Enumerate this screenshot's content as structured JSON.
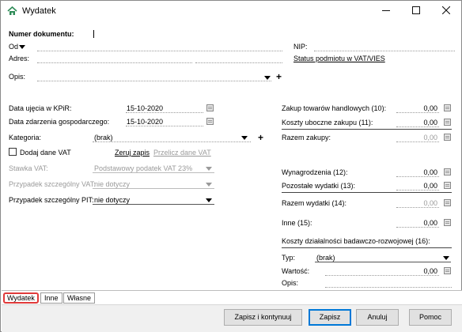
{
  "window": {
    "title": "Wydatek",
    "minimize_icon": "minimize-icon",
    "maximize_icon": "maximize-icon",
    "close_icon": "close-icon"
  },
  "header": {
    "numer_label": "Numer dokumentu:",
    "od_label": "Od",
    "adres_label": "Adres:",
    "nip_label": "NIP:",
    "status_link": "Status podmiotu w VAT/VIES",
    "opis_label": "Opis:"
  },
  "left": {
    "data_ujecia_label": "Data ujęcia w KPiR:",
    "data_ujecia_value": "15-10-2020",
    "data_zdarzenia_label": "Data zdarzenia gospodarczego:",
    "data_zdarzenia_value": "15-10-2020",
    "kategoria_label": "Kategoria:",
    "kategoria_value": "(brak)",
    "dodaj_vat_label": "Dodaj dane VAT",
    "zeruj_link": "Zeruj zapis",
    "przelicz_link": "Przelicz dane VAT",
    "stawka_label": "Stawka VAT:",
    "stawka_value": "Podstawowy podatek VAT 23%",
    "przypadek_vat_label": "Przypadek szczególny VAT:",
    "przypadek_vat_value": "nie dotyczy",
    "przypadek_pit_label": "Przypadek szczególny PIT:",
    "przypadek_pit_value": "nie dotyczy"
  },
  "right": {
    "zakup_label": "Zakup towarów handlowych (10):",
    "zakup_value": "0,00",
    "koszty_uboczne_label": "Koszty uboczne zakupu (11):",
    "koszty_uboczne_value": "0,00",
    "razem_zakupy_label": "Razem zakupy:",
    "razem_zakupy_value": "0,00",
    "wynagrodzenia_label": "Wynagrodzenia (12):",
    "wynagrodzenia_value": "0,00",
    "pozostale_label": "Pozostałe wydatki (13):",
    "pozostale_value": "0,00",
    "razem_wydatki_label": "Razem wydatki (14):",
    "razem_wydatki_value": "0,00",
    "inne_label": "Inne (15):",
    "inne_value": "0,00",
    "koszty_br_label": "Koszty działalności badawczo-rozwojowej (16):",
    "typ_label": "Typ:",
    "typ_value": "(brak)",
    "wartosc_label": "Wartość:",
    "wartosc_value": "0,00",
    "opis_label": "Opis:"
  },
  "tabs": [
    "Wydatek",
    "Inne",
    "Własne"
  ],
  "buttons": {
    "zapisz_kontynuuj": "Zapisz i kontynuuj",
    "zapisz": "Zapisz",
    "anuluj": "Anuluj",
    "pomoc": "Pomoc"
  }
}
